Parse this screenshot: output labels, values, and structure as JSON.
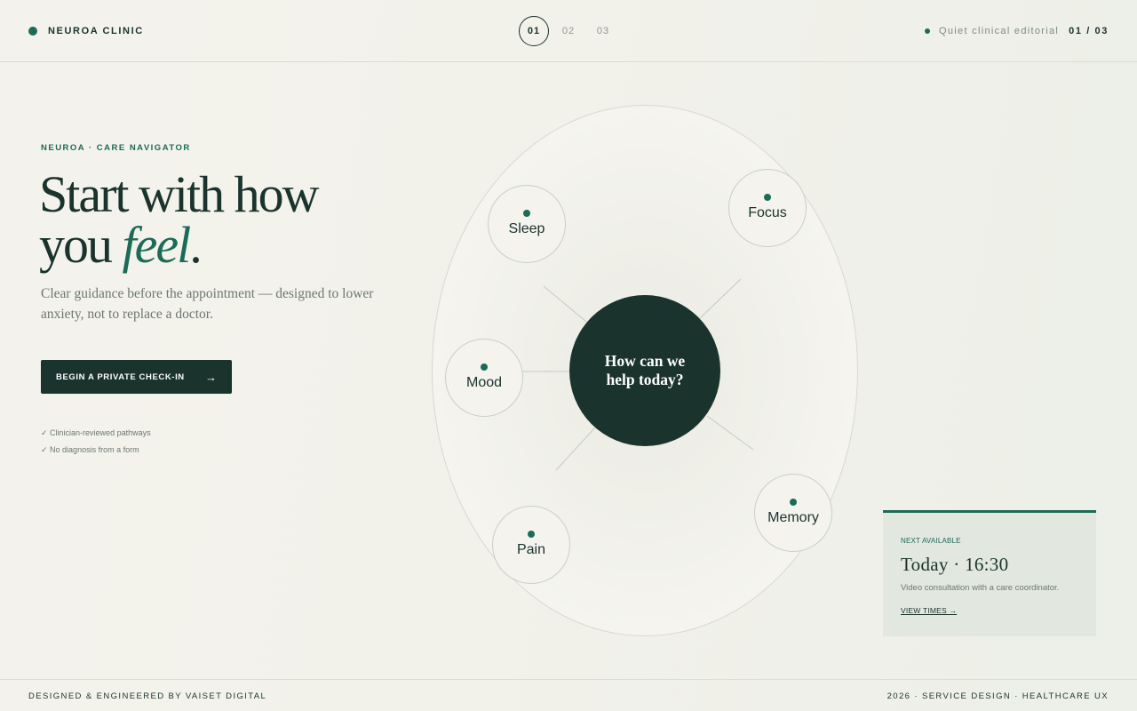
{
  "header": {
    "brand": "NEUROA CLINIC",
    "steps": [
      "01",
      "02",
      "03"
    ],
    "active_step": 0,
    "tagline": "Quiet clinical editorial",
    "counter": "01 / 03"
  },
  "intro": {
    "eyebrow": "NEUROA · CARE NAVIGATOR",
    "headline_line1": "Start with how",
    "headline_line2_prefix": "you ",
    "headline_accent": "feel",
    "headline_suffix": ".",
    "lede": "Clear guidance before the appointment — designed to lower anxiety, not to replace a doctor.",
    "cta_label": "BEGIN A PRIVATE CHECK-IN",
    "cta_arrow": "→",
    "checks": [
      "✓ Clinician-reviewed pathways",
      "✓ No diagnosis from a form"
    ]
  },
  "orbit": {
    "hub_label": "How can we help today?",
    "nodes": [
      "Sleep",
      "Focus",
      "Mood",
      "Memory",
      "Pain"
    ]
  },
  "availability": {
    "eyebrow": "NEXT AVAILABLE",
    "time": "Today · 16:30",
    "description": "Video consultation with a care coordinator.",
    "link_label": "VIEW TIMES →"
  },
  "footer": {
    "left": "DESIGNED & ENGINEERED BY VAISET DIGITAL",
    "right": "2026 · SERVICE DESIGN · HEALTHCARE UX"
  },
  "colors": {
    "brand_green": "#1b6b58",
    "ink": "#1a332d",
    "muted": "#6d7773"
  }
}
